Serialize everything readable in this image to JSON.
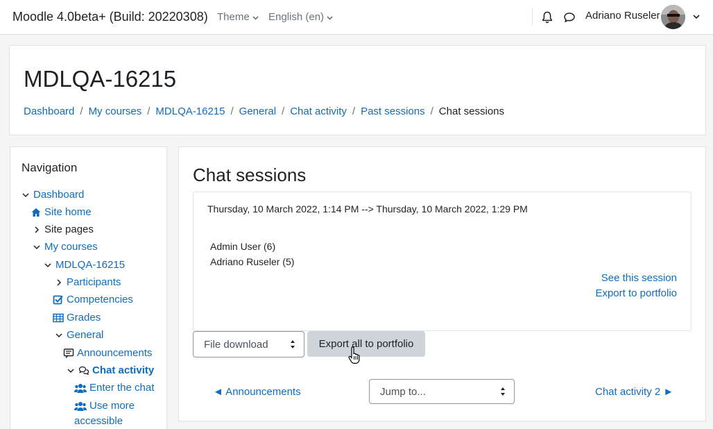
{
  "navbar": {
    "brand": "Moodle 4.0beta+ (Build: 20220308)",
    "theme_label": "Theme",
    "language_label": "English (en)",
    "user_name": "Adriano Ruseler",
    "icons": [
      "bell-icon",
      "chat-bubble-icon",
      "chevron-down-icon"
    ]
  },
  "header": {
    "title": "MDLQA-16215",
    "breadcrumb": [
      "Dashboard",
      "My courses",
      "MDLQA-16215",
      "General",
      "Chat activity",
      "Past sessions",
      "Chat sessions"
    ]
  },
  "navigation": {
    "title": "Navigation",
    "items": [
      {
        "label": "Dashboard",
        "icon": "chevron-down-icon"
      },
      {
        "label": "Site home",
        "icon": "home-icon"
      },
      {
        "label": "Site pages",
        "icon": "chevron-right-icon"
      },
      {
        "label": "My courses",
        "icon": "chevron-down-icon"
      },
      {
        "label": "MDLQA-16215",
        "icon": "chevron-down-icon"
      },
      {
        "label": "Participants",
        "icon": "chevron-right-icon"
      },
      {
        "label": "Competencies",
        "icon": "checkbox-icon"
      },
      {
        "label": "Grades",
        "icon": "table-icon"
      },
      {
        "label": "General",
        "icon": "chevron-down-icon"
      },
      {
        "label": "Announcements",
        "icon": "forum-icon"
      },
      {
        "label": "Chat activity",
        "icon": "chat-icon"
      },
      {
        "label": "Enter the chat",
        "icon": "users-icon"
      },
      {
        "label": "Use more",
        "icon": "users-icon"
      },
      {
        "label": "accessible",
        "icon": ""
      }
    ]
  },
  "main": {
    "title": "Chat sessions",
    "session": {
      "range": "Thursday, 10 March 2022, 1:14 PM --> Thursday, 10 March 2022, 1:29 PM",
      "participants": [
        "Admin User (6)",
        "Adriano Ruseler (5)"
      ],
      "see_link": "See this session",
      "export_link": "Export to portfolio"
    },
    "export_select": "File download",
    "export_all_button": "Export all to portfolio",
    "prev_link": "◄ Announcements",
    "jump_select": "Jump to...",
    "next_link": "Chat activity 2 ►"
  },
  "colors": {
    "link": "#0f6cbf",
    "text": "#1d2125",
    "border": "#dee2e6",
    "button": "#ced4da"
  }
}
